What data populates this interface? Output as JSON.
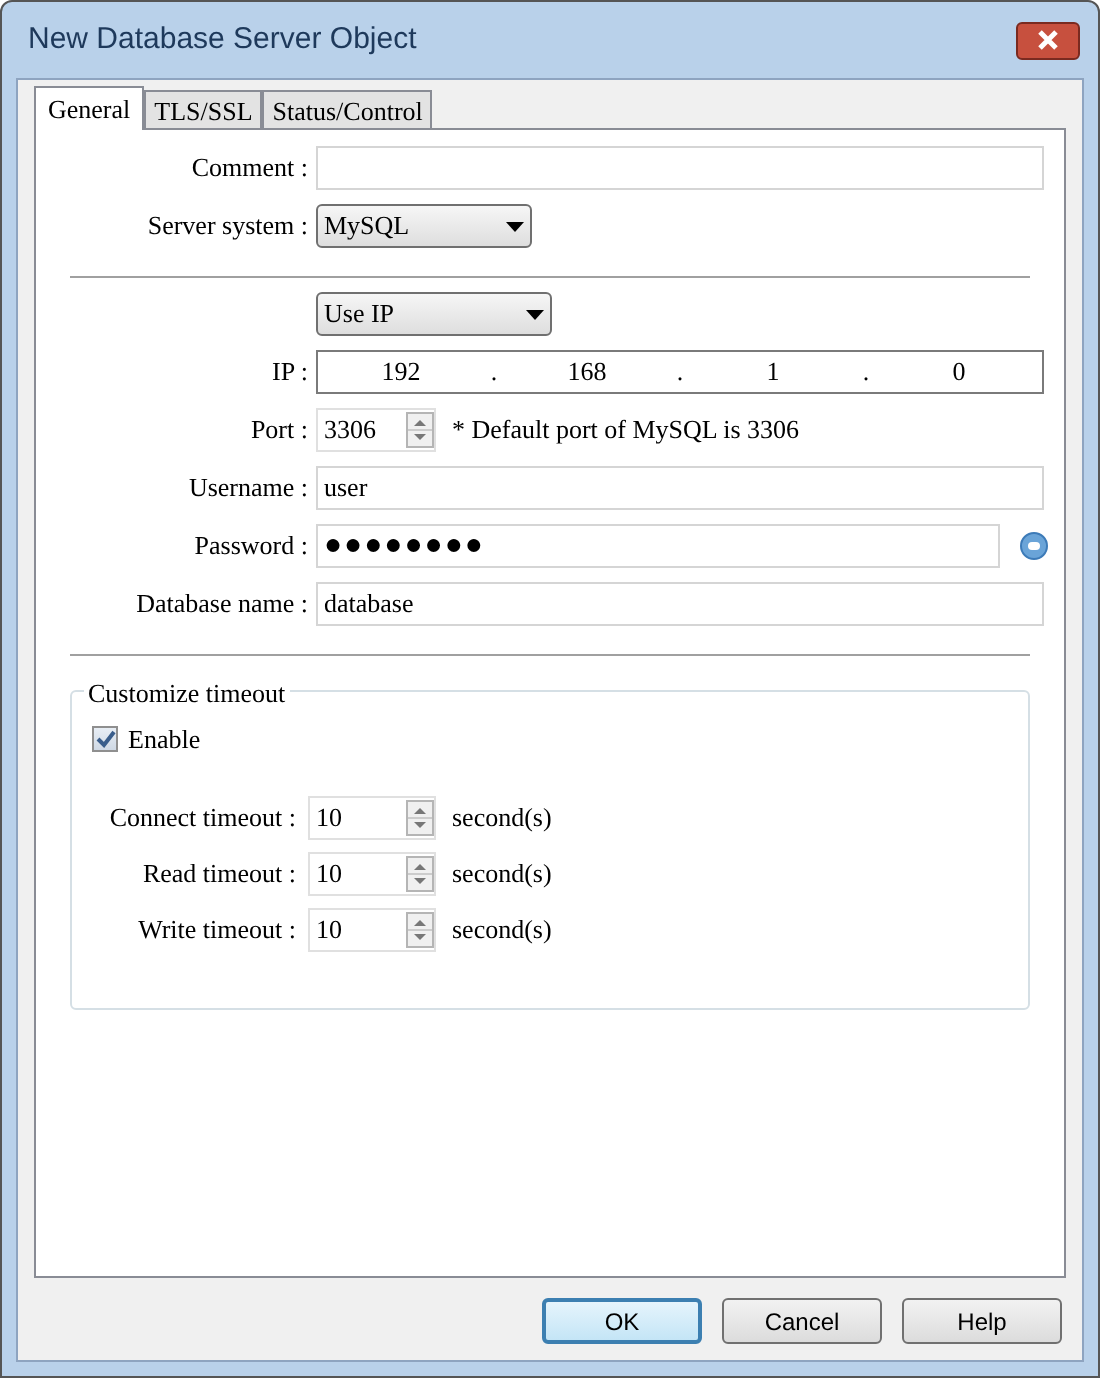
{
  "window": {
    "title": "New Database Server Object"
  },
  "tabs": [
    {
      "label": "General",
      "selected": true
    },
    {
      "label": "TLS/SSL",
      "selected": false
    },
    {
      "label": "Status/Control",
      "selected": false
    }
  ],
  "rows": [
    {
      "kind": "text",
      "label": "Comment :"
    },
    {
      "kind": "dropdown",
      "label": "Server system :",
      "value": "MySQL"
    },
    {
      "kind": "divider"
    },
    {
      "kind": "dropdown",
      "value": "Use IP"
    },
    {
      "kind": "ip",
      "label": "IP :",
      "octets": [
        "192",
        "168",
        "1",
        "0"
      ],
      "separators": [
        ".",
        ".",
        "."
      ]
    },
    {
      "kind": "spin",
      "label": "Port :",
      "value": "3306",
      "note": "* Default port of MySQL is 3306"
    },
    {
      "kind": "text",
      "label": "Username :",
      "value": "user"
    },
    {
      "kind": "password",
      "label": "Password :",
      "value": "●●●●●●●●"
    },
    {
      "kind": "text",
      "label": "Database name :",
      "value": "database"
    },
    {
      "kind": "divider"
    }
  ],
  "timeout": {
    "title": "Customize timeout",
    "enable": {
      "label": "Enable",
      "checked": true
    },
    "rows": [
      {
        "label": "Connect timeout :",
        "value": "10",
        "unit": "second(s)"
      },
      {
        "label": "Read timeout :",
        "value": "10",
        "unit": "second(s)"
      },
      {
        "label": "Write timeout :",
        "value": "10",
        "unit": "second(s)"
      }
    ]
  },
  "buttons": [
    {
      "label": "OK",
      "default": true
    },
    {
      "label": "Cancel",
      "default": false
    },
    {
      "label": "Help",
      "default": false
    }
  ]
}
